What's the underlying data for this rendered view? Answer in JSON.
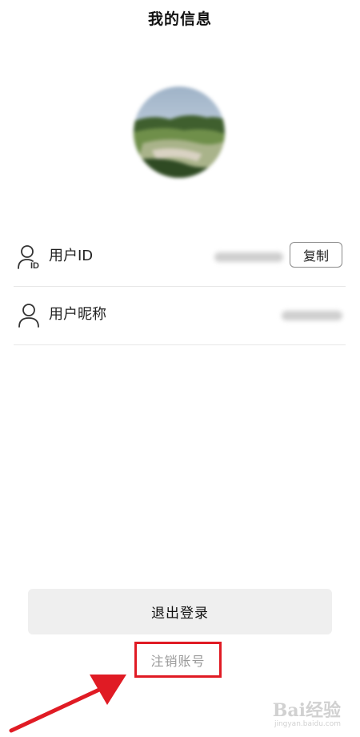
{
  "header": {
    "title": "我的信息"
  },
  "profile": {
    "avatar_icon": "avatar-landscape-photo",
    "rows": [
      {
        "icon": "user-id-icon",
        "label": "用户ID",
        "action_label": "复制"
      },
      {
        "icon": "user-icon",
        "label": "用户昵称"
      }
    ]
  },
  "actions": {
    "logout_label": "退出登录",
    "cancel_account_label": "注销账号"
  },
  "annotation": {
    "highlight_color": "#e01b24",
    "arrow_color": "#e01b24"
  },
  "watermark": {
    "brand": "Bai经验",
    "url": "jingyan.baidu.com"
  }
}
